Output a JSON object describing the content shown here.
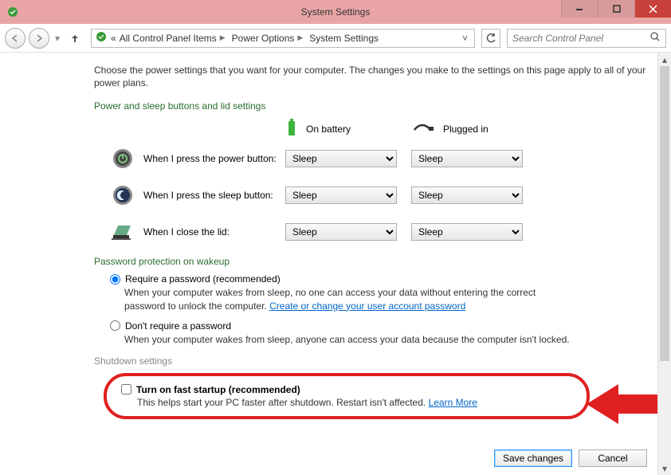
{
  "window": {
    "title": "System Settings"
  },
  "breadcrumb": {
    "prefix": "«",
    "items": [
      "All Control Panel Items",
      "Power Options",
      "System Settings"
    ]
  },
  "search": {
    "placeholder": "Search Control Panel"
  },
  "intro": "Choose the power settings that you want for your computer. The changes you make to the settings on this page apply to all of your power plans.",
  "section1_title": "Power and sleep buttons and lid settings",
  "cols": {
    "battery": "On battery",
    "plugged": "Plugged in"
  },
  "rows": {
    "power": {
      "label": "When I press the power button:",
      "battery": "Sleep",
      "plugged": "Sleep"
    },
    "sleep": {
      "label": "When I press the sleep button:",
      "battery": "Sleep",
      "plugged": "Sleep"
    },
    "lid": {
      "label": "When I close the lid:",
      "battery": "Sleep",
      "plugged": "Sleep"
    }
  },
  "section2_title": "Password protection on wakeup",
  "pw_req": {
    "label": "Require a password (recommended)",
    "desc_pre": "When your computer wakes from sleep, no one can access your data without entering the correct password to unlock the computer. ",
    "link": "Create or change your user account password"
  },
  "pw_noreq": {
    "label": "Don't require a password",
    "desc": "When your computer wakes from sleep, anyone can access your data because the computer isn't locked."
  },
  "section3_title": "Shutdown settings",
  "fast": {
    "title": "Turn on fast startup (recommended)",
    "desc": "This helps start your PC faster after shutdown. Restart isn't affected. ",
    "link": "Learn More"
  },
  "buttons": {
    "save": "Save changes",
    "cancel": "Cancel"
  }
}
